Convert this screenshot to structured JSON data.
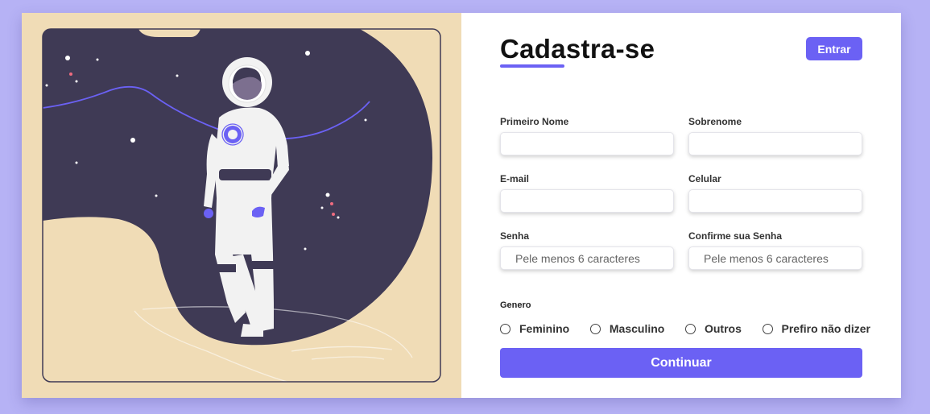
{
  "form": {
    "title": "Cadastra-se",
    "login_button": "Entrar",
    "fields": {
      "first_name": {
        "label": "Primeiro Nome",
        "value": "",
        "placeholder": ""
      },
      "last_name": {
        "label": "Sobrenome",
        "value": "",
        "placeholder": ""
      },
      "email": {
        "label": "E-mail",
        "value": "",
        "placeholder": ""
      },
      "phone": {
        "label": "Celular",
        "value": "",
        "placeholder": ""
      },
      "password": {
        "label": "Senha",
        "value": "",
        "placeholder": "Pele menos 6 caracteres"
      },
      "confirm_password": {
        "label": "Confirme sua Senha",
        "value": "",
        "placeholder": "Pele menos 6 caracteres"
      }
    },
    "gender": {
      "title": "Genero",
      "options": [
        "Feminino",
        "Masculino",
        "Outros",
        "Prefiro não dizer"
      ]
    },
    "submit_button": "Continuar"
  },
  "colors": {
    "accent": "#6b61f4",
    "page_background": "#b6b2f5",
    "illustration_sand": "#f0dcb6",
    "illustration_space": "#3f3a55"
  },
  "illustration": {
    "subject": "astronaut-illustration"
  }
}
